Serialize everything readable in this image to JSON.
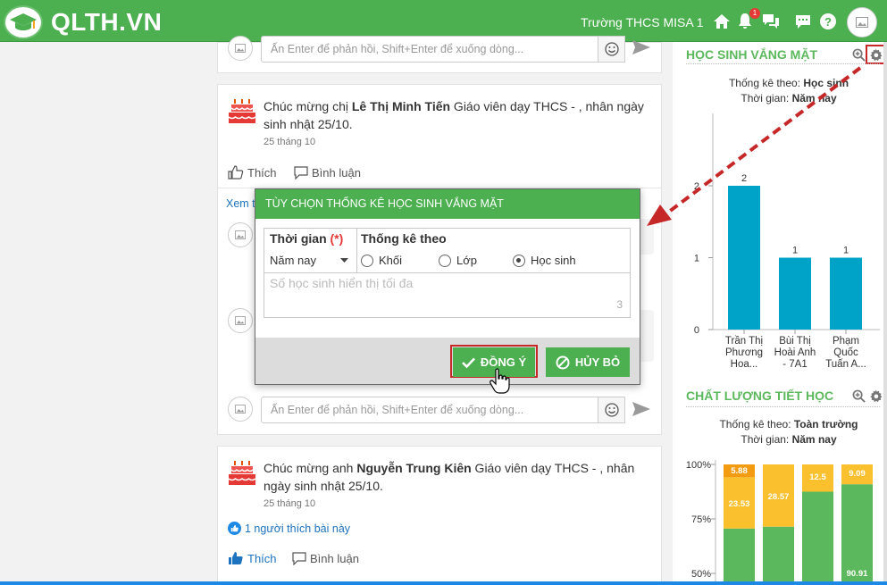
{
  "header": {
    "brand": "QLTH.VN",
    "school": "Trường THCS MISA 1",
    "notif_count": "1"
  },
  "feed": {
    "reply_placeholder": "Ấn Enter để phản hồi, Shift+Enter để xuống dòng...",
    "see_more_prefix": "Xem t",
    "posts": [
      {
        "prefix": "Chúc mừng chị ",
        "name": "Lê Thị Minh Tiến",
        "suffix": " Giáo viên dạy THCS - , nhân ngày sinh nhật 25/10.",
        "date": "25 tháng 10",
        "like_label": "Thích",
        "comment_label": "Bình luận"
      },
      {
        "prefix": "Chúc mừng anh ",
        "name": "Nguyễn Trung Kiên",
        "suffix": " Giáo viên dạy THCS - , nhân ngày sinh nhật 25/10.",
        "date": "25 tháng 10",
        "likes_text": "1 người thích bài này",
        "like_label": "Thích",
        "comment_label": "Bình luận"
      }
    ]
  },
  "modal": {
    "title": "TÙY CHỌN THỐNG KÊ HỌC SINH VẮNG MẶT",
    "time_label": "Thời gian",
    "required_mark": "(*)",
    "time_value": "Năm nay",
    "stat_label": "Thống kê theo",
    "options": [
      "Khối",
      "Lớp",
      "Học sinh"
    ],
    "selected_option": "Học sinh",
    "max_placeholder": "Số học sinh hiển thị tối đa",
    "max_value": "3",
    "ok_label": "ĐỒNG Ý",
    "cancel_label": "HỦY BỎ"
  },
  "absent_panel": {
    "title": "HỌC SINH VẮNG MẶT",
    "stat_by_label": "Thống kê theo: ",
    "stat_by_value": "Học sinh",
    "time_label": "Thời gian: ",
    "time_value": "Năm nay"
  },
  "quality_panel": {
    "title": "CHẤT LƯỢNG TIẾT HỌC",
    "stat_by_label": "Thống kê theo: ",
    "stat_by_value": "Toàn trường",
    "time_label": "Thời gian: ",
    "time_value": "Năm nay"
  },
  "colors": {
    "brand_green": "#4caf50",
    "bar_blue": "#00a3c8",
    "good_green": "#5cb85c",
    "mid_yellow": "#fbc02d",
    "low_orange": "#f39c12",
    "highlight_red": "#c62828"
  },
  "chart_data": [
    {
      "type": "bar",
      "categories": [
        "Trần Thị Phương Hoa...",
        "Bùi Thị Hoài Anh - 7A1",
        "Phạm Quốc Tuấn A..."
      ],
      "category_lines": [
        [
          "Trần Thị",
          "Phương",
          "Hoa..."
        ],
        [
          "Bùi Thị",
          "Hoài Anh",
          "- 7A1"
        ],
        [
          "Phạm",
          "Quốc",
          "Tuấn A..."
        ]
      ],
      "values": [
        2,
        1,
        1
      ],
      "yticks": [
        0,
        1,
        2
      ],
      "ylim": [
        0,
        2
      ],
      "data_labels": true
    },
    {
      "type": "bar",
      "stacked": true,
      "percent": true,
      "yticks": [
        "50%",
        "75%",
        "100%"
      ],
      "ylim": [
        50,
        100
      ],
      "series": [
        {
          "values": [
            70.59,
            71.43,
            87.5,
            90.91
          ],
          "labels": [
            "",
            "",
            "",
            "90.91"
          ],
          "color": "#5cb85c"
        },
        {
          "values": [
            23.53,
            28.57,
            12.5,
            9.09
          ],
          "labels": [
            "23.53",
            "28.57",
            "12.5",
            "9.09"
          ],
          "color": "#fbc02d"
        },
        {
          "values": [
            5.88,
            0,
            0,
            0
          ],
          "labels": [
            "5.88",
            "",
            "",
            ""
          ],
          "color": "#f39c12"
        }
      ]
    }
  ]
}
